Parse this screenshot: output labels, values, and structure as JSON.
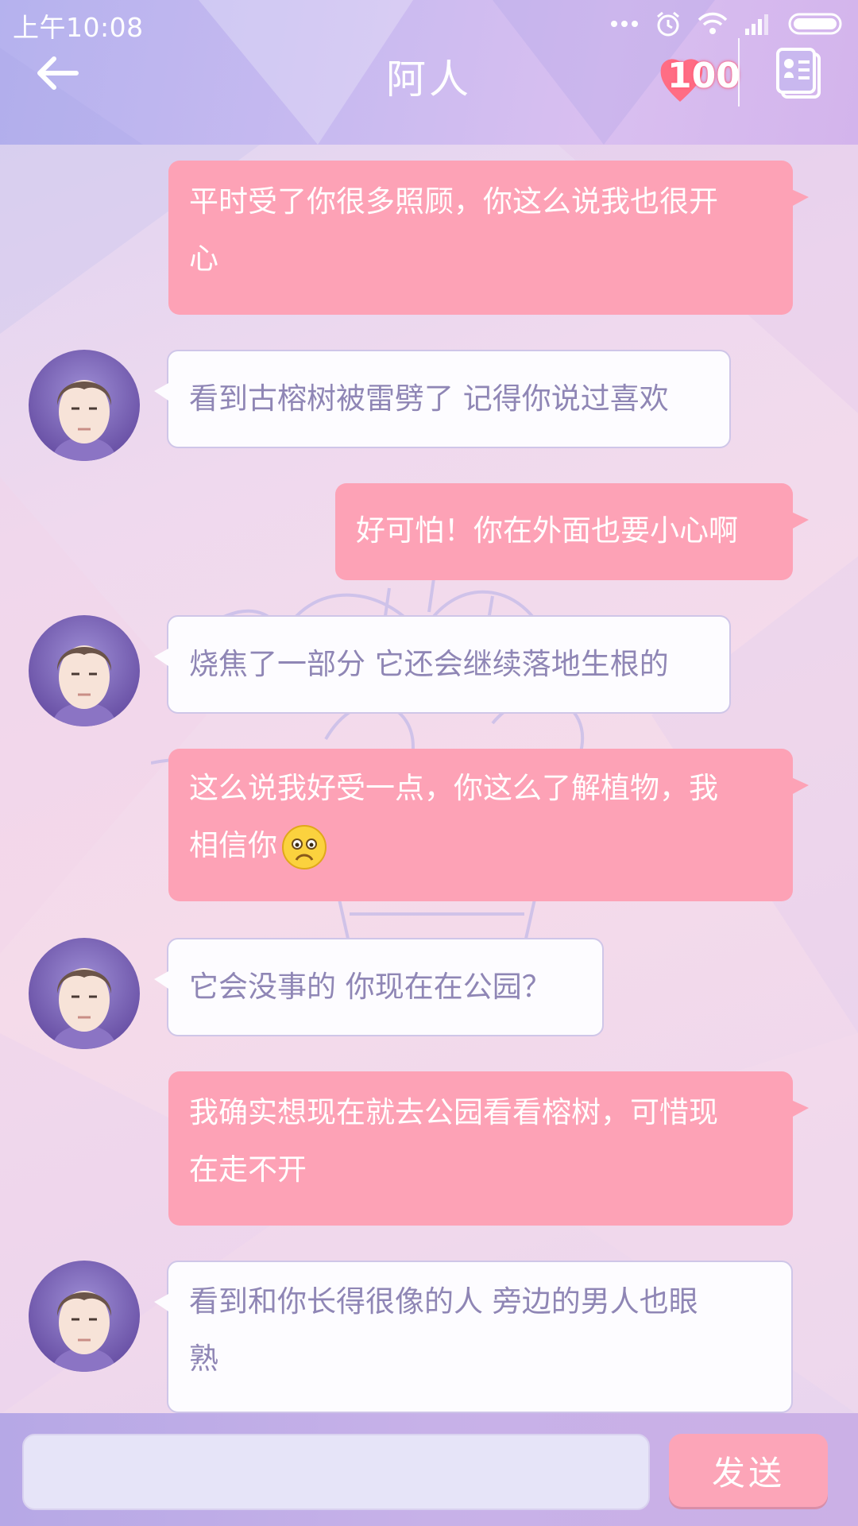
{
  "status_bar": {
    "time": "上午10:08",
    "icons": [
      "more-dots-icon",
      "alarm-icon",
      "wifi-icon",
      "signal-icon",
      "battery-icon"
    ]
  },
  "header": {
    "title": "阿人",
    "affection_count": "100",
    "back_icon": "back-arrow-icon",
    "contact_icon": "contact-card-icon"
  },
  "messages": [
    {
      "side": "out",
      "text": "平时受了你很多照顾，你这么说我也很开\n心"
    },
    {
      "side": "in",
      "text": "看到古榕树被雷劈了 记得你说过喜欢"
    },
    {
      "side": "out",
      "text": "好可怕！你在外面也要小心啊"
    },
    {
      "side": "in",
      "text": "烧焦了一部分 它还会继续落地生根的"
    },
    {
      "side": "out",
      "text": "这么说我好受一点，你这么了解植物，我\n相信你",
      "emoji": "sad-face-emoji"
    },
    {
      "side": "in",
      "text": "它会没事的 你现在在公园？"
    },
    {
      "side": "out",
      "text": "我确实想现在就去公园看看榕树，可惜现\n在走不开"
    },
    {
      "side": "in",
      "text": "看到和你长得很像的人 旁边的男人也眼\n熟"
    }
  ],
  "input": {
    "value": "",
    "placeholder": "",
    "send_label": "发送"
  },
  "colors": {
    "outgoing_bubble": "#fda2b6",
    "incoming_text": "#8f86b5",
    "header": "#c8baf0"
  }
}
